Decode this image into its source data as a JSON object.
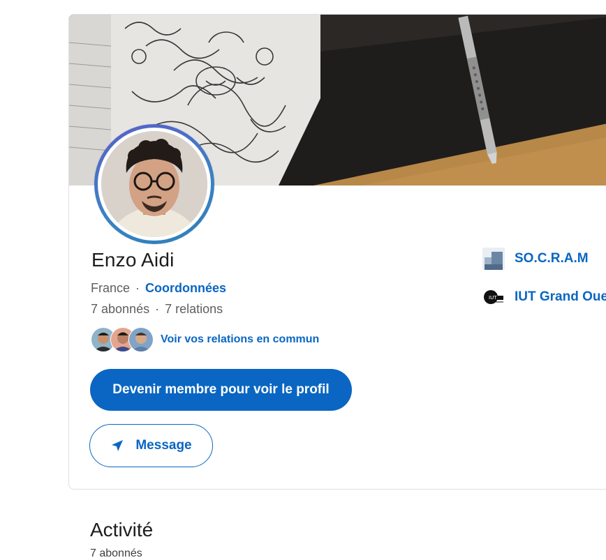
{
  "profile": {
    "name": "Enzo Aidi",
    "location": "France",
    "contact_link": "Coordonnées",
    "followers": "7 abonnés",
    "connections": "7 relations",
    "mutual_link": "Voir vos relations en commun"
  },
  "actions": {
    "join_label": "Devenir membre pour voir le profil",
    "message_label": "Message"
  },
  "organizations": [
    {
      "name": "SO.C.R.A.M",
      "icon": "company-logo"
    },
    {
      "name": "IUT Grand Oue",
      "icon": "school-logo"
    }
  ],
  "activity": {
    "title": "Activité",
    "subtitle": "7 abonnés"
  },
  "colors": {
    "accent": "#0a66c2",
    "text": "#1d1d1d",
    "muted": "#5e5e5e"
  }
}
